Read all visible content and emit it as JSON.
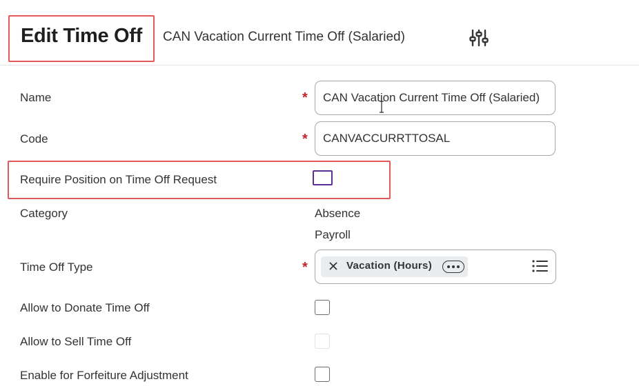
{
  "header": {
    "title": "Edit Time Off",
    "subtitle": "CAN Vacation Current Time Off (Salaried)",
    "filter_icon": "sliders-icon"
  },
  "form": {
    "required_marker": "*",
    "name": {
      "label": "Name",
      "value": "CAN Vacation Current Time Off (Salaried)"
    },
    "code": {
      "label": "Code",
      "value": "CANVACCURRTTOSAL"
    },
    "require_position": {
      "label": "Require Position on Time Off Request",
      "checked": false
    },
    "category": {
      "label": "Category",
      "values": [
        "Absence",
        "Payroll"
      ]
    },
    "time_off_type": {
      "label": "Time Off Type",
      "selected": "Vacation (Hours)",
      "remove_icon": "close-icon",
      "more_icon": "ellipsis-icon",
      "list_icon": "list-icon"
    },
    "allow_donate": {
      "label": "Allow to Donate Time Off",
      "checked": false
    },
    "allow_sell": {
      "label": "Allow to Sell Time Off",
      "checked": false,
      "disabled": true
    },
    "forfeiture": {
      "label": "Enable for Forfeiture Adjustment",
      "checked": false
    }
  },
  "colors": {
    "highlight_border": "#e0585c",
    "required": "#c0262d",
    "focus_border": "#5b2d99"
  }
}
